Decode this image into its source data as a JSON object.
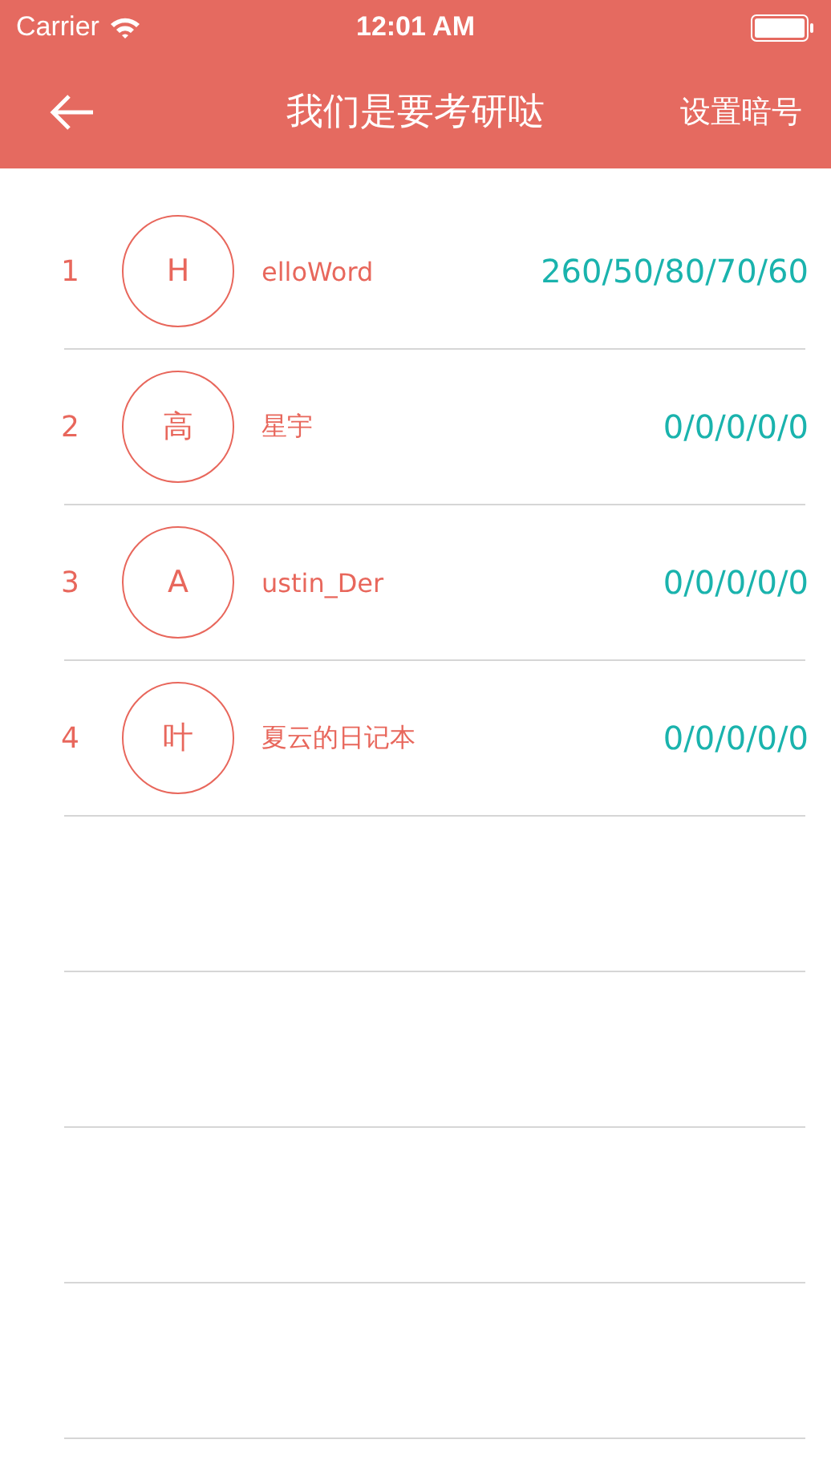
{
  "status_bar": {
    "carrier": "Carrier",
    "time": "12:01 AM"
  },
  "nav_bar": {
    "title": "我们是要考研哒",
    "action": "设置暗号"
  },
  "rows": [
    {
      "rank": "1",
      "avatar": "H",
      "name": "elloWord",
      "scores": "260/50/80/70/60"
    },
    {
      "rank": "2",
      "avatar": "高",
      "name": "星宇",
      "scores": "0/0/0/0/0"
    },
    {
      "rank": "3",
      "avatar": "A",
      "name": "ustin_Der",
      "scores": "0/0/0/0/0"
    },
    {
      "rank": "4",
      "avatar": "叶",
      "name": "夏云的日记本",
      "scores": "0/0/0/0/0"
    }
  ]
}
